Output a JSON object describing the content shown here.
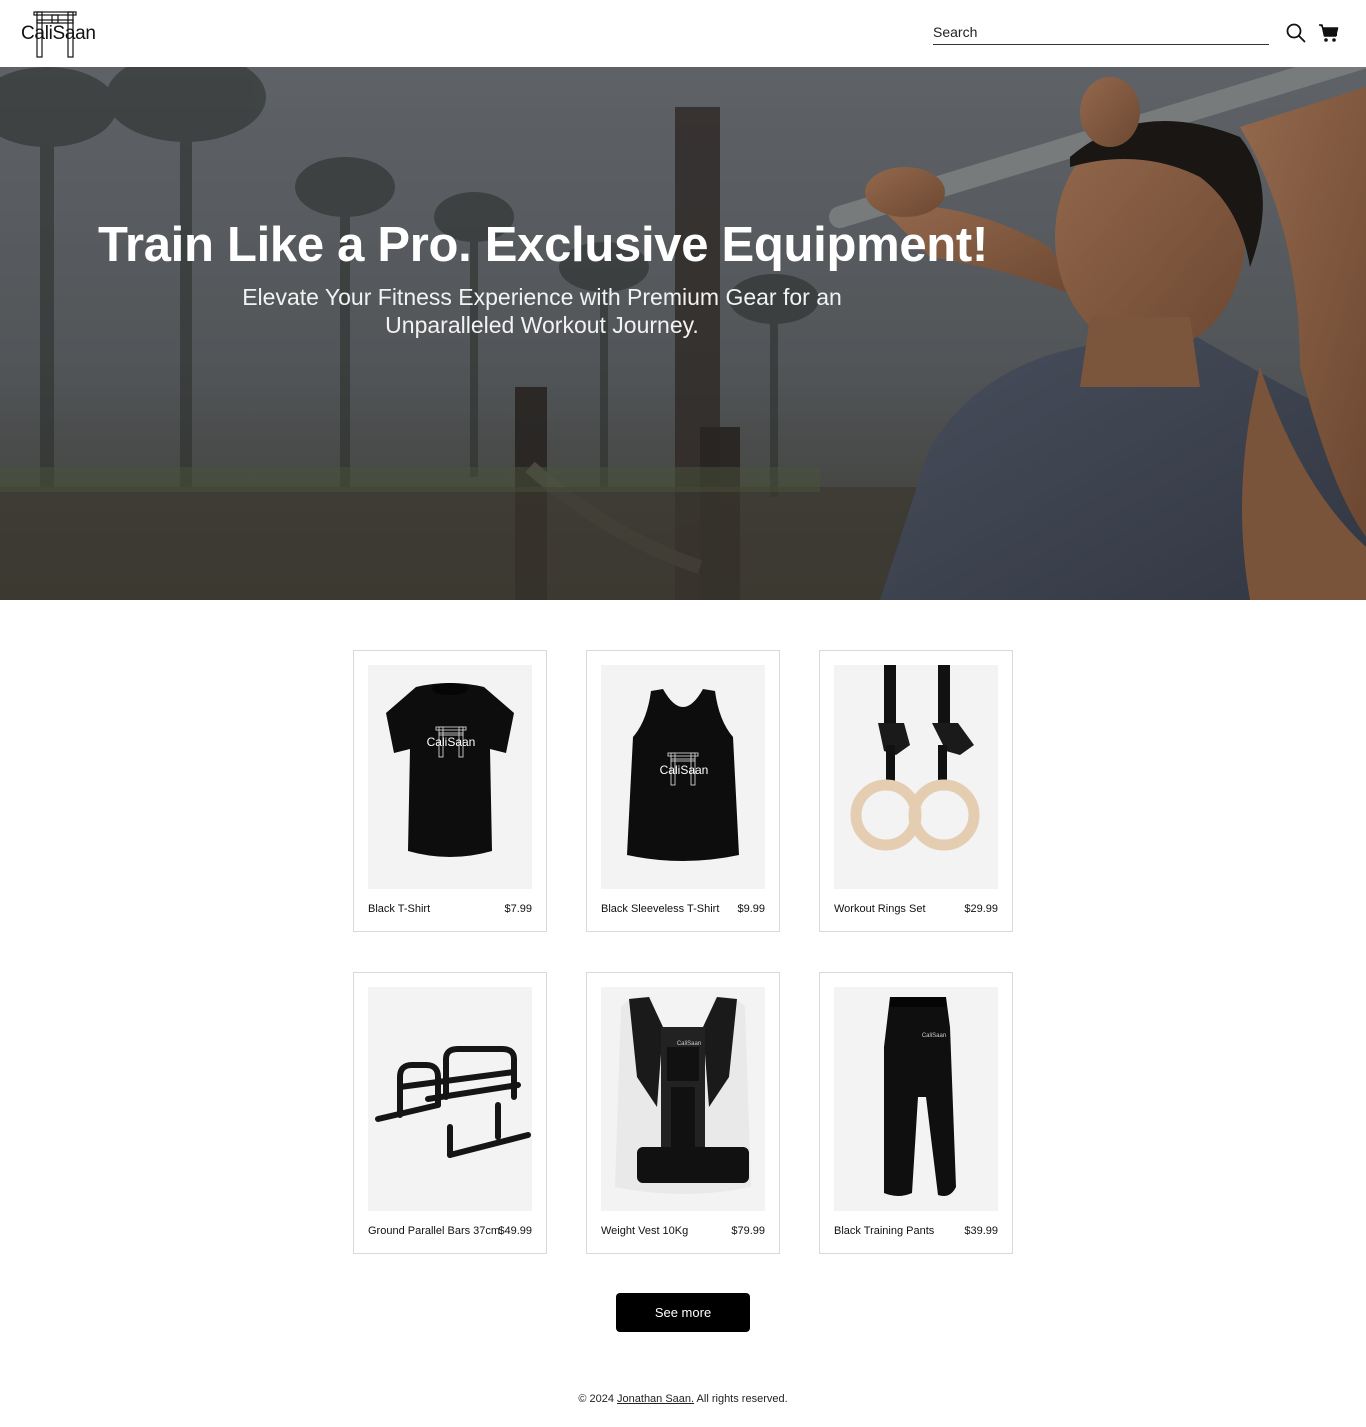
{
  "header": {
    "logo_text": "CaliSaan",
    "search_placeholder": "Search"
  },
  "hero": {
    "title": "Train Like a Pro. Exclusive Equipment!",
    "subtitle": "Elevate Your Fitness Experience with Premium Gear for an Unparalleled Workout Journey."
  },
  "products": [
    {
      "name": "Black T-Shirt",
      "price": "$7.99",
      "image": "tshirt-image",
      "print": "CaliSaan"
    },
    {
      "name": "Black Sleeveless T-Shirt",
      "price": "$9.99",
      "image": "tank-top-image",
      "print": "CaliSaan"
    },
    {
      "name": "Workout Rings Set",
      "price": "$29.99",
      "image": "rings-image"
    },
    {
      "name": "Ground Parallel Bars 37cm",
      "price": "$49.99",
      "image": "parallel-bars-image"
    },
    {
      "name": "Weight Vest 10Kg",
      "price": "$79.99",
      "image": "weight-vest-image",
      "print": "CaliSaan"
    },
    {
      "name": "Black Training Pants",
      "price": "$39.99",
      "image": "pants-image",
      "print": "CaliSaan"
    }
  ],
  "see_more_label": "See more",
  "footer": {
    "prefix": "© 2024 ",
    "author": "Jonathan Saan.",
    "suffix": " All rights reserved."
  },
  "colors": {
    "button_bg": "#000000",
    "card_border": "#d9d9d9",
    "image_bg": "#f3f3f3"
  }
}
